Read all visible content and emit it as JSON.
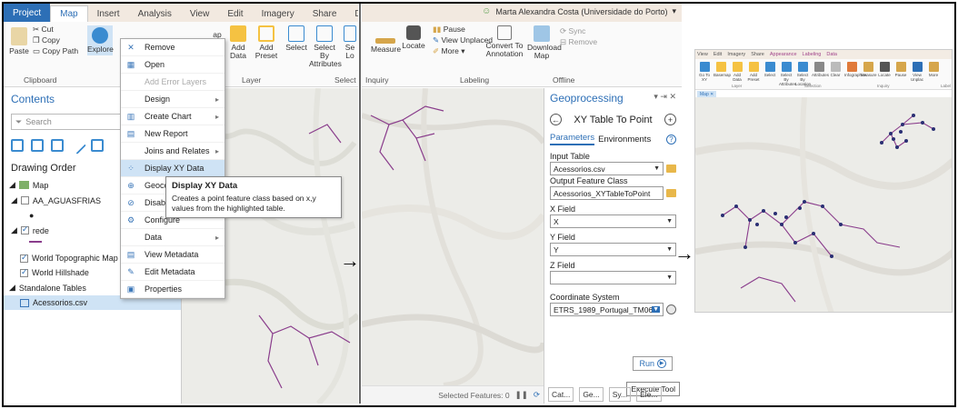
{
  "panel1": {
    "tabs": [
      "Project",
      "Map",
      "Insert",
      "Analysis",
      "View",
      "Edit",
      "Imagery",
      "Share",
      "Dat"
    ],
    "ribbon": {
      "cut": "Cut",
      "copy": "Copy",
      "paste": "Paste",
      "copy_path": "Copy Path",
      "explore": "Explore",
      "clipboard_group": "Clipboard",
      "basemap_partial": "ap",
      "add_data": "Add Data",
      "add_preset": "Add Preset",
      "layer_group": "Layer",
      "select": "Select",
      "select_by_attributes": "Select By Attributes",
      "select_partial": "Se Lo",
      "select_group": "Select"
    },
    "contents": {
      "title": "Contents",
      "search_placeholder": "Search",
      "drawing_order": "Drawing Order",
      "map": "Map",
      "aa_aguasfrias": "AA_AGUASFRIAS",
      "rede": "rede",
      "world_topo": "World Topographic Map",
      "world_hillshade": "World Hillshade",
      "standalone_tables": "Standalone Tables",
      "acessorios": "Acessorios.csv"
    },
    "menu": [
      {
        "label": "Remove",
        "icon": "x-icon"
      },
      {
        "label": "Open",
        "icon": "table-icon"
      },
      {
        "label": "Add Error Layers",
        "icon": "",
        "disabled": true
      },
      {
        "label": "Design",
        "arrow": true
      },
      {
        "label": "Create Chart",
        "arrow": true
      },
      {
        "label": "New Report"
      },
      {
        "label": "Joins and Relates",
        "arrow": true
      },
      {
        "label": "Display XY Data",
        "highlight": true
      },
      {
        "label": "Geocode T"
      },
      {
        "label": "Disable Po"
      },
      {
        "label": "Configure"
      },
      {
        "label": "Data",
        "arrow": true
      },
      {
        "label": "View Metadata"
      },
      {
        "label": "Edit Metadata"
      },
      {
        "label": "Properties"
      }
    ],
    "tooltip": {
      "title": "Display XY Data",
      "body": "Creates a point feature class based on x,y values from the highlighted table."
    }
  },
  "panel2": {
    "user": "Marta Alexandra Costa (Universidade do Porto)",
    "ribbon": {
      "measure": "Measure",
      "locate": "Locate",
      "inquiry_group": "Inquiry",
      "pause": "Pause",
      "view_unplaced": "View Unplaced",
      "more": "More",
      "convert_to_annotation": "Convert To Annotation",
      "labeling_group": "Labeling",
      "download_map": "Download Map",
      "sync": "Sync",
      "remove": "Remove",
      "offline_group": "Offline"
    },
    "geoprocessing": {
      "title": "Geoprocessing",
      "tool": "XY Table To Point",
      "tab_parameters": "Parameters",
      "tab_environments": "Environments",
      "input_table_label": "Input Table",
      "input_table_value": "Acessorios.csv",
      "output_label": "Output Feature Class",
      "output_value": "Acessorios_XYTableToPoint",
      "x_label": "X Field",
      "x_value": "X",
      "y_label": "Y Field",
      "y_value": "Y",
      "z_label": "Z Field",
      "z_value": "",
      "cs_label": "Coordinate System",
      "cs_value": "ETRS_1989_Portugal_TM06",
      "run": "Run",
      "execute_tip": "Execute Tool",
      "bottom_tabs": [
        "Cat...",
        "Ge...",
        "Sy...",
        "Ele..."
      ]
    },
    "status": {
      "selected": "Selected Features: 0"
    }
  },
  "panel3": {
    "tabs": [
      "View",
      "Edit",
      "Imagery",
      "Share",
      "Appearance",
      "Labeling",
      "Data"
    ],
    "ribbon": [
      "Go To XY",
      "Basemap",
      "Add Data",
      "Add Preset",
      "Select",
      "Select By Attributes",
      "Select By Location",
      "Attributes",
      "Clear",
      "Infographics",
      "Measure",
      "Locate",
      "Pause",
      "View Unplac",
      "More"
    ],
    "groups": [
      "Layer",
      "Selection",
      "Inquiry",
      "Label"
    ],
    "map_tab": "Map"
  },
  "colors": {
    "accent": "#2d6fb6",
    "line": "#8a3d8c",
    "point": "#2a2f73"
  }
}
